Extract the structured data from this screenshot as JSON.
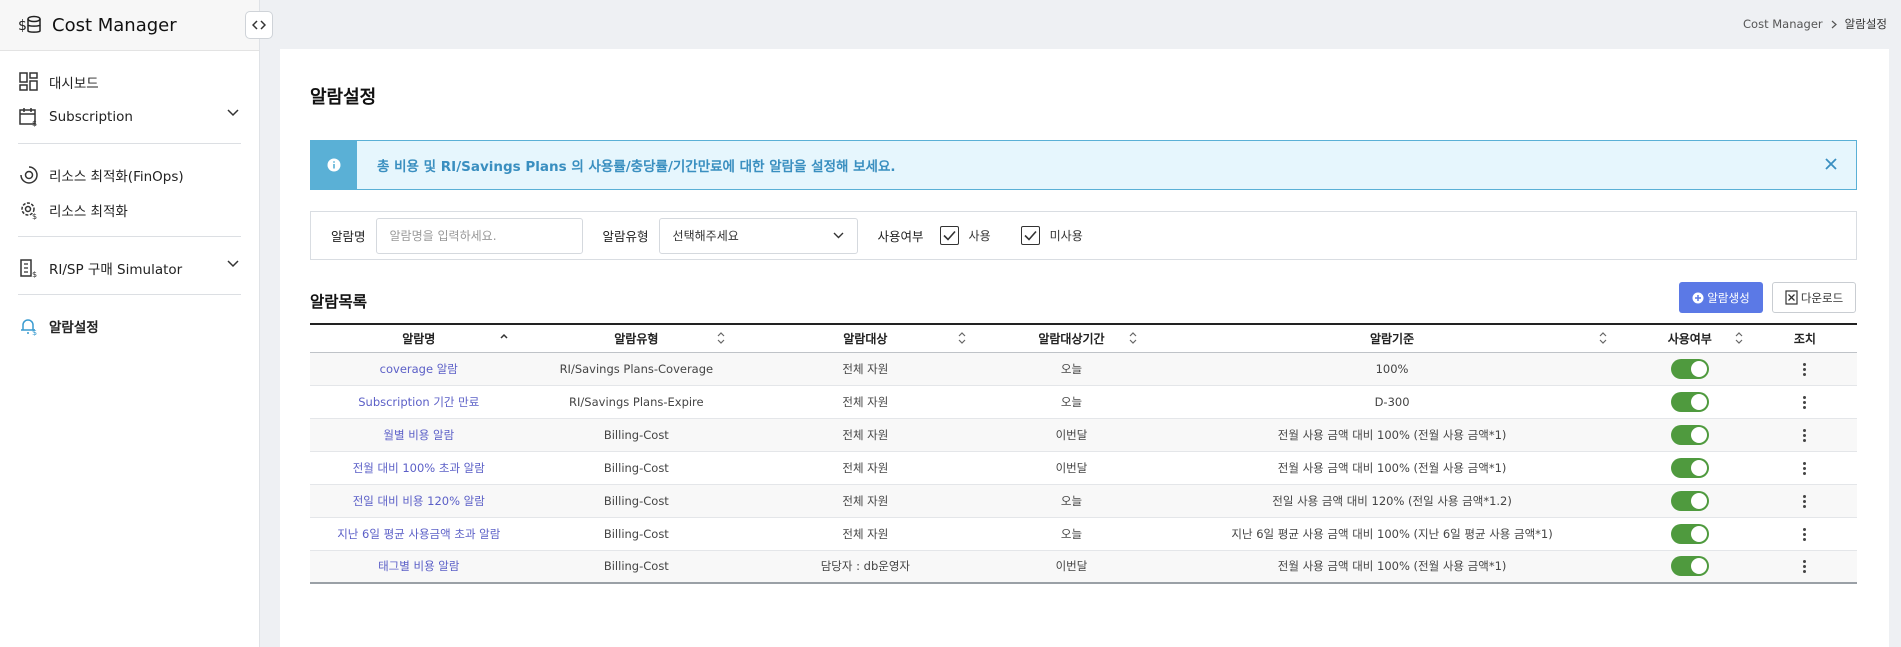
{
  "app": {
    "title": "Cost Manager"
  },
  "sidebar": {
    "items": [
      {
        "label": "대시보드",
        "icon": "dashboard-icon"
      },
      {
        "label": "Subscription",
        "icon": "calendar-icon"
      },
      {
        "label": "리소스 최적화(FinOps)",
        "icon": "eye-icon"
      },
      {
        "label": "리소스 최적화",
        "icon": "gear-dollar-icon"
      },
      {
        "label": "RI/SP 구매 Simulator",
        "icon": "building-dollar-icon"
      },
      {
        "label": "알람설정",
        "icon": "bell-dollar-icon"
      }
    ]
  },
  "breadcrumb": {
    "root": "Cost Manager",
    "current": "알람설정"
  },
  "page": {
    "title": "알람설정"
  },
  "notice": {
    "text": "총 비용 및 RI/Savings Plans 의 사용률/충당률/기간만료에 대한 알람을 설정해 보세요."
  },
  "filter": {
    "name_label": "알람명",
    "name_placeholder": "알람명을 입력하세요.",
    "type_label": "알람유형",
    "type_value": "선택해주세요",
    "usage_label": "사용여부",
    "use_label": "사용",
    "unuse_label": "미사용"
  },
  "list": {
    "title": "알람목록",
    "create_label": "알람생성",
    "download_label": "다운로드",
    "columns": [
      "알람명",
      "알람유형",
      "알람대상",
      "알람대상기간",
      "알람기준",
      "사용여부",
      "조치"
    ],
    "rows": [
      {
        "name": "coverage 알람",
        "type": "RI/Savings Plans-Coverage",
        "target": "전체 자원",
        "period": "오늘",
        "criteria": "100%",
        "enabled": true
      },
      {
        "name": "Subscription 기간 만료",
        "type": "RI/Savings Plans-Expire",
        "target": "전체 자원",
        "period": "오늘",
        "criteria": "D-300",
        "enabled": true
      },
      {
        "name": "월별 비용 알람",
        "type": "Billing-Cost",
        "target": "전체 자원",
        "period": "이번달",
        "criteria": "전월 사용 금액 대비 100% (전월 사용 금액*1)",
        "enabled": true
      },
      {
        "name": "전월 대비 100% 초과 알람",
        "type": "Billing-Cost",
        "target": "전체 자원",
        "period": "이번달",
        "criteria": "전월 사용 금액 대비 100% (전월 사용 금액*1)",
        "enabled": true
      },
      {
        "name": "전일 대비 비용 120% 알람",
        "type": "Billing-Cost",
        "target": "전체 자원",
        "period": "오늘",
        "criteria": "전일 사용 금액 대비 120% (전일 사용 금액*1.2)",
        "enabled": true
      },
      {
        "name": "지난 6일 평균 사용금액 초과 알람",
        "type": "Billing-Cost",
        "target": "전체 자원",
        "period": "오늘",
        "criteria": "지난 6일 평균 사용 금액 대비 100% (지난 6일 평균 사용 금액*1)",
        "enabled": true
      },
      {
        "name": "태그별 비용 알람",
        "type": "Billing-Cost",
        "target": "담당자 : db운영자",
        "period": "이번달",
        "criteria": "전월 사용 금액 대비 100% (전월 사용 금액*1)",
        "enabled": true
      }
    ]
  },
  "colors": {
    "accent": "#5b79e6",
    "toggle_on": "#4f9a3e",
    "notice_border": "#5ab0d6",
    "link": "#5b5fc7"
  }
}
